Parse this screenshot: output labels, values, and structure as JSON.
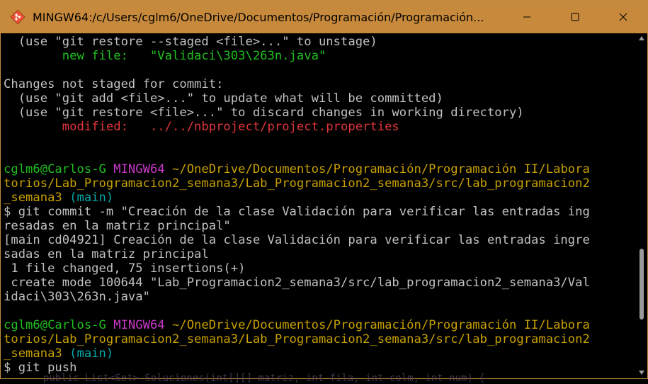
{
  "window": {
    "title": "MINGW64:/c/Users/cglm6/OneDrive/Documentos/Programación/Programación...",
    "controls": [
      "minimize",
      "maximize",
      "close"
    ],
    "accent_color": "#c7893c"
  },
  "terminal": {
    "lines": [
      {
        "segments": [
          {
            "text": "  (use \"git restore --staged <file>...\" to unstage)",
            "cls": ""
          }
        ]
      },
      {
        "segments": [
          {
            "text": "        new file:   \"Validaci\\303\\263n.java\"",
            "cls": "green"
          }
        ]
      },
      {
        "segments": [
          {
            "text": "",
            "cls": ""
          }
        ]
      },
      {
        "segments": [
          {
            "text": "Changes not staged for commit:",
            "cls": ""
          }
        ]
      },
      {
        "segments": [
          {
            "text": "  (use \"git add <file>...\" to update what will be committed)",
            "cls": ""
          }
        ]
      },
      {
        "segments": [
          {
            "text": "  (use \"git restore <file>...\" to discard changes in working directory)",
            "cls": ""
          }
        ]
      },
      {
        "segments": [
          {
            "text": "        modified:   ../../nbproject/project.properties",
            "cls": "red"
          }
        ]
      },
      {
        "segments": [
          {
            "text": "",
            "cls": ""
          }
        ]
      },
      {
        "segments": [
          {
            "text": "",
            "cls": ""
          }
        ]
      },
      {
        "segments": [
          {
            "text": "cglm6@Carlos-G ",
            "cls": "user"
          },
          {
            "text": "MINGW64 ",
            "cls": "mingw"
          },
          {
            "text": "~/OneDrive/Documentos/Programación/Programación II/Labora",
            "cls": "path"
          }
        ]
      },
      {
        "segments": [
          {
            "text": "torios/Lab_Programacion2_semana3/Lab_Programacion2_semana3/src/lab_programacion2",
            "cls": "path"
          }
        ]
      },
      {
        "segments": [
          {
            "text": "_semana3 ",
            "cls": "path"
          },
          {
            "text": "(main)",
            "cls": "branch"
          }
        ]
      },
      {
        "segments": [
          {
            "text": "$ git commit -m \"Creación de la clase Validación para verificar las entradas ing",
            "cls": ""
          }
        ]
      },
      {
        "segments": [
          {
            "text": "resadas en la matriz principal\"",
            "cls": ""
          }
        ]
      },
      {
        "segments": [
          {
            "text": "[main cd04921] Creación de la clase Validación para verificar las entradas ingre",
            "cls": ""
          }
        ]
      },
      {
        "segments": [
          {
            "text": "sadas en la matriz principal",
            "cls": ""
          }
        ]
      },
      {
        "segments": [
          {
            "text": " 1 file changed, 75 insertions(+)",
            "cls": ""
          }
        ]
      },
      {
        "segments": [
          {
            "text": " create mode 100644 \"Lab_Programacion2_semana3/src/lab_programacion2_semana3/Val",
            "cls": ""
          }
        ]
      },
      {
        "segments": [
          {
            "text": "idaci\\303\\263n.java\"",
            "cls": ""
          }
        ]
      },
      {
        "segments": [
          {
            "text": "",
            "cls": ""
          }
        ]
      },
      {
        "segments": [
          {
            "text": "cglm6@Carlos-G ",
            "cls": "user"
          },
          {
            "text": "MINGW64 ",
            "cls": "mingw"
          },
          {
            "text": "~/OneDrive/Documentos/Programación/Programación II/Labora",
            "cls": "path"
          }
        ]
      },
      {
        "segments": [
          {
            "text": "torios/Lab_Programacion2_semana3/Lab_Programacion2_semana3/src/lab_programacion2",
            "cls": "path"
          }
        ]
      },
      {
        "segments": [
          {
            "text": "_semana3 ",
            "cls": "path"
          },
          {
            "text": "(main)",
            "cls": "branch"
          }
        ]
      },
      {
        "segments": [
          {
            "text": "$ git push",
            "cls": ""
          }
        ]
      }
    ]
  },
  "background_peek": "public List<Set> Soluciones(int[][] matriz, int fila, int colm, int num) {"
}
